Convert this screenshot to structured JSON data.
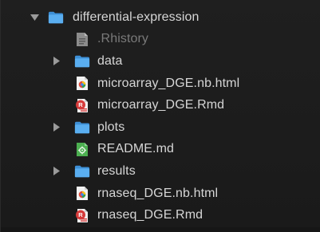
{
  "colors": {
    "folder": "#4fa3ea",
    "background": "#1e1e1e",
    "text": "#d6d6d6",
    "dim_text": "#7a7a7a",
    "rmd_red": "#d63b3b",
    "md_green": "#4caf50"
  },
  "tree": {
    "root": {
      "label": "differential-expression",
      "icon": "folder-icon",
      "expanded": true
    },
    "items": [
      {
        "label": ".Rhistory",
        "icon": "history-file-icon",
        "type": "file"
      },
      {
        "label": "data",
        "icon": "folder-icon",
        "type": "folder"
      },
      {
        "label": "microarray_DGE.nb.html",
        "icon": "html-notebook-icon",
        "type": "file"
      },
      {
        "label": "microarray_DGE.Rmd",
        "icon": "rmarkdown-icon",
        "type": "file"
      },
      {
        "label": "plots",
        "icon": "folder-icon",
        "type": "folder"
      },
      {
        "label": "README.md",
        "icon": "markdown-icon",
        "type": "file"
      },
      {
        "label": "results",
        "icon": "folder-icon",
        "type": "folder"
      },
      {
        "label": "rnaseq_DGE.nb.html",
        "icon": "html-notebook-icon",
        "type": "file"
      },
      {
        "label": "rnaseq_DGE.Rmd",
        "icon": "rmarkdown-icon",
        "type": "file"
      }
    ]
  }
}
